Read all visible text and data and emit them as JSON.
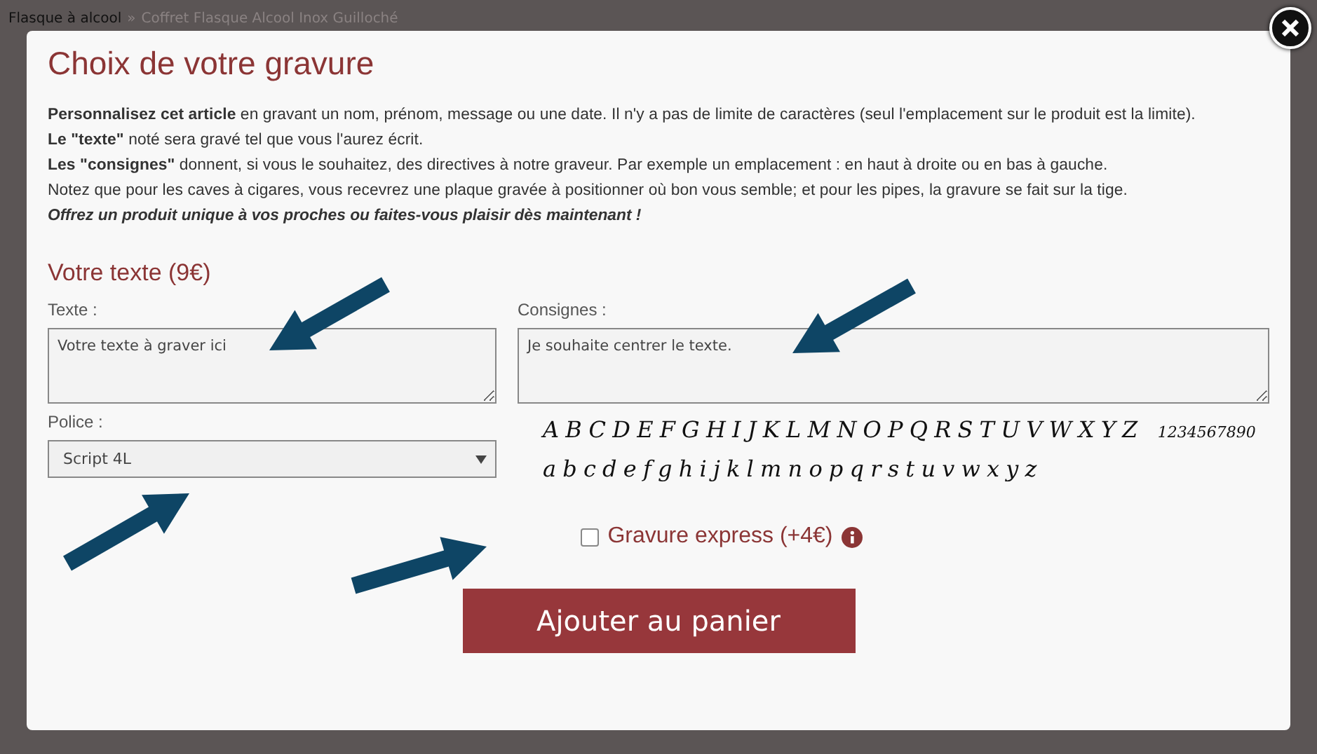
{
  "breadcrumb": [
    "Flasque à alcool",
    "Coffret Flasque Alcool Inox Guilloché"
  ],
  "breadcrumb_separator": "»",
  "dialog": {
    "title": "Choix de votre gravure",
    "intro": [
      {
        "kind": "normal",
        "text": "**Personnalisez cet article** en gravant un nom, prénom, message ou une date. Il n'y a pas de limite de caractères (seul l'emplacement sur le produit est la limite)."
      },
      {
        "kind": "normal",
        "text": "**Le \"texte\"** noté sera gravé tel que vous l'aurez écrit."
      },
      {
        "kind": "normal",
        "text": "**Les \"consignes\"** donnent, si vous le souhaitez, des directives à notre graveur. Par exemple un emplacement : en haut à droite ou en bas à gauche."
      },
      {
        "kind": "normal",
        "text": "Notez que pour les caves à cigares, vous recevrez une plaque gravée à positionner où bon vous semble; et pour les pipes, la gravure se fait sur la tige."
      },
      {
        "kind": "emphasis",
        "text": "Offrez un produit unique à vos proches ou faites-vous plaisir dès maintenant !"
      }
    ],
    "section_title": "Votre texte (9€)",
    "text_field": {
      "label": "Texte :",
      "value": "Votre texte à graver ici"
    },
    "instructions_field": {
      "label": "Consignes :",
      "value": "Je souhaite centrer le texte."
    },
    "font_select": {
      "label": "Police :",
      "value": "Script 4L"
    },
    "font_sample": {
      "uppercase": "ABCDEFGHIJKLMNOPQRSTUVWXYZ",
      "digits": "1234567890",
      "lowercase": "abcdefghijklmnopqrstuvwxyz"
    },
    "express": {
      "label": "Gravure express (+4€)",
      "checked": false
    },
    "button": "Ajouter au panier"
  }
}
